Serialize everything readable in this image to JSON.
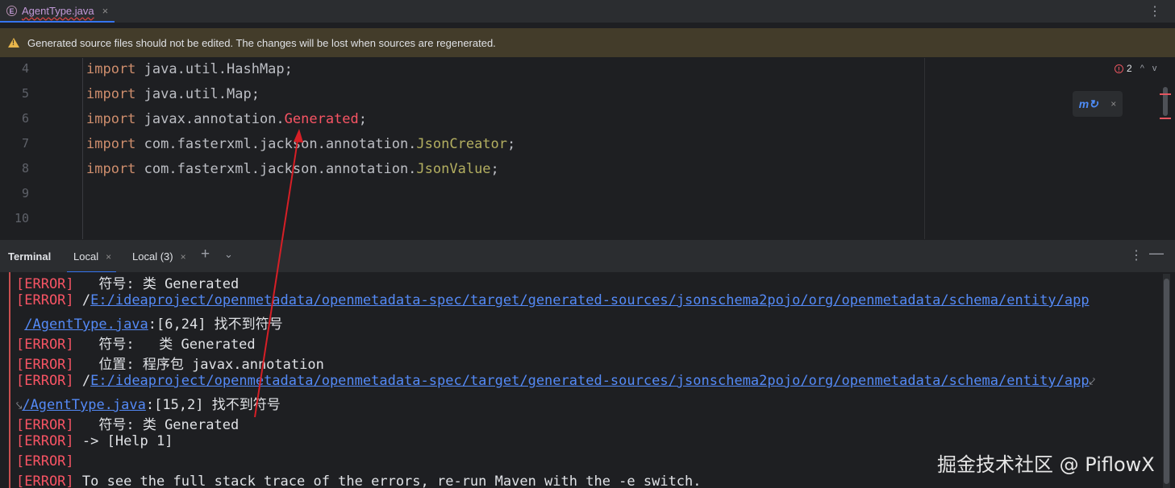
{
  "editor_tab": {
    "label": "AgentType.java",
    "icon_letter": "E",
    "close": "×"
  },
  "tab_more": "⋮",
  "banner": {
    "text": "Generated source files should not be edited. The changes will be lost when sources are regenerated."
  },
  "code_lines": [
    {
      "n": "4",
      "parts": [
        {
          "t": "import",
          "c": "kw"
        },
        {
          "t": " java.util.HashMap;",
          "c": ""
        }
      ]
    },
    {
      "n": "5",
      "parts": [
        {
          "t": "import",
          "c": "kw"
        },
        {
          "t": " java.util.Map;",
          "c": ""
        }
      ]
    },
    {
      "n": "6",
      "parts": [
        {
          "t": "import",
          "c": "kw"
        },
        {
          "t": " javax.annotation.",
          "c": ""
        },
        {
          "t": "Generated",
          "c": "err-ref"
        },
        {
          "t": ";",
          "c": ""
        }
      ]
    },
    {
      "n": "7",
      "parts": [
        {
          "t": "import",
          "c": "kw"
        },
        {
          "t": " com.fasterxml.jackson.annotation.",
          "c": ""
        },
        {
          "t": "JsonCreator",
          "c": "ann"
        },
        {
          "t": ";",
          "c": ""
        }
      ]
    },
    {
      "n": "8",
      "parts": [
        {
          "t": "import",
          "c": "kw"
        },
        {
          "t": " com.fasterxml.jackson.annotation.",
          "c": ""
        },
        {
          "t": "JsonValue",
          "c": "ann"
        },
        {
          "t": ";",
          "c": ""
        }
      ]
    },
    {
      "n": "9",
      "parts": []
    },
    {
      "n": "10",
      "parts": []
    }
  ],
  "error_counter": {
    "count": "2",
    "up": "^",
    "down": "v"
  },
  "popup_close": "×",
  "terminal": {
    "title": "Terminal",
    "tabs": [
      {
        "label": "Local",
        "close": "×"
      },
      {
        "label": "Local (3)",
        "close": "×"
      }
    ],
    "new_tab": "+",
    "dropdown": "⌄",
    "more": "⋮",
    "minimize": "—",
    "lines": [
      [
        {
          "t": "[ERROR]",
          "c": "err"
        },
        {
          "t": "   符号: 类 Generated",
          "c": ""
        }
      ],
      [
        {
          "t": "[ERROR]",
          "c": "err"
        },
        {
          "t": " /",
          "c": ""
        },
        {
          "t": "E:/ideaproject/openmetadata/openmetadata-spec/target/generated-sources/jsonschema2pojo/org/openmetadata/schema/entity/app",
          "c": "link"
        }
      ],
      [
        {
          "t": " ",
          "c": ""
        },
        {
          "t": "/AgentType.java",
          "c": "link"
        },
        {
          "t": ":[6,24] 找不到符号",
          "c": ""
        }
      ],
      [
        {
          "t": "[ERROR]",
          "c": "err"
        },
        {
          "t": "   符号:   类 Generated",
          "c": ""
        }
      ],
      [
        {
          "t": "[ERROR]",
          "c": "err"
        },
        {
          "t": "   位置: 程序包 javax.annotation",
          "c": ""
        }
      ],
      [
        {
          "t": "[ERROR]",
          "c": "err"
        },
        {
          "t": " /",
          "c": ""
        },
        {
          "t": "E:/ideaproject/openmetadata/openmetadata-spec/target/generated-sources/jsonschema2pojo/org/openmetadata/schema/entity/app",
          "c": "link"
        },
        {
          "t": "⤦",
          "c": "wrapmark"
        }
      ],
      [
        {
          "t": "⤥",
          "c": "wrapmark"
        },
        {
          "t": "/AgentType.java",
          "c": "link"
        },
        {
          "t": ":[15,2] 找不到符号",
          "c": ""
        }
      ],
      [
        {
          "t": "[ERROR]",
          "c": "err"
        },
        {
          "t": "   符号: 类 Generated",
          "c": ""
        }
      ],
      [
        {
          "t": "[ERROR]",
          "c": "err"
        },
        {
          "t": " -> [Help 1]",
          "c": ""
        }
      ],
      [
        {
          "t": "[ERROR]",
          "c": "err"
        }
      ],
      [
        {
          "t": "[ERROR]",
          "c": "err"
        },
        {
          "t": " To see the full stack trace of the errors, re-run Maven with the -e switch.",
          "c": ""
        }
      ]
    ]
  },
  "watermark": "掘金技术社区 @ PiflowX",
  "colors": {
    "accent": "#3574f0",
    "error": "#f75464",
    "keyword": "#cf8e6d",
    "annotation": "#b3ae60",
    "link": "#548af7",
    "arrow": "#d61f26"
  }
}
